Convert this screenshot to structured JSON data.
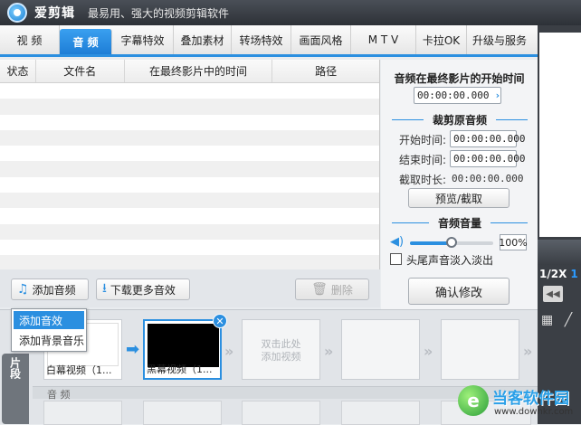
{
  "app": {
    "name": "爱剪辑",
    "slogan": "最易用、强大的视频剪辑软件"
  },
  "tabs": [
    {
      "label": "视  频",
      "active": false
    },
    {
      "label": "音  频",
      "active": true
    },
    {
      "label": "字幕特效",
      "active": false
    },
    {
      "label": "叠加素材",
      "active": false
    },
    {
      "label": "转场特效",
      "active": false
    },
    {
      "label": "画面风格",
      "active": false
    },
    {
      "label": "M T V",
      "active": false
    },
    {
      "label": "卡拉OK",
      "active": false
    },
    {
      "label": "升级与服务",
      "active": false
    }
  ],
  "audio_list": {
    "columns": [
      "状态",
      "文件名",
      "在最终影片中的时间",
      "路径"
    ]
  },
  "buttons": {
    "add_audio": "添加音频",
    "download_more": "下载更多音效",
    "delete": "删除"
  },
  "popup_menu": {
    "items": [
      "添加音效",
      "添加背景音乐"
    ],
    "highlighted": 0
  },
  "settings": {
    "start_title": "音频在最终影片的开始时间",
    "start_time": "00:00:00.000",
    "trim_title": "裁剪原音频",
    "start_label": "开始时间:",
    "start_value": "00:00:00.000",
    "end_label": "结束时间:",
    "end_value": "00:00:00.000",
    "duration_label": "截取时长:",
    "duration_value": "00:00:00.000",
    "preview_button": "预览/截取",
    "volume_title": "音频音量",
    "volume_value": "100%",
    "volume_level": 0.5,
    "fade_label": "头尾声音淡入淡出",
    "fade_checked": false,
    "confirm_button": "确认修改"
  },
  "player": {
    "speed_label": "1/2X",
    "speed_label2": "1"
  },
  "timeline": {
    "side_tab": "片段",
    "clips": [
      {
        "caption": "白幕视频（1...",
        "type": "white"
      },
      {
        "caption": "黑幕视频（1...",
        "type": "black"
      }
    ],
    "add_placeholder_line1": "双击此处",
    "add_placeholder_line2": "添加视频",
    "audio_track_label": "音 频"
  },
  "watermark": {
    "name": "当客软件园",
    "url": "www.downkr.com"
  },
  "colors": {
    "accent": "#2b8fe0",
    "title_bar": "#2d3137"
  }
}
